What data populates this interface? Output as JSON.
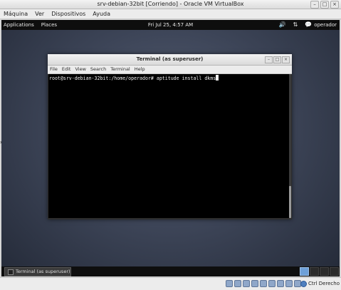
{
  "vbox": {
    "title": "srv-debian-32bit [Corriendo] - Oracle VM VirtualBox",
    "menus": [
      "Máquina",
      "Ver",
      "Dispositivos",
      "Ayuda"
    ],
    "host_key_label": "Ctrl Derecho"
  },
  "gnome": {
    "applications_label": "Applications",
    "places_label": "Places",
    "clock": "Fri Jul 25,  4:57 AM",
    "username": "operador"
  },
  "terminal": {
    "title": "Terminal (as superuser)",
    "menus": [
      "File",
      "Edit",
      "View",
      "Search",
      "Terminal",
      "Help"
    ],
    "prompt_line": "root@srv-debian-32bit:/home/operador# aptitude install dkms"
  },
  "taskbar": {
    "window_label": "Terminal (as superuser)"
  },
  "colors": {
    "terminal_bg": "#000000",
    "panel_bg": "#0e0e0e",
    "workspace_active": "#6ea0d8"
  }
}
